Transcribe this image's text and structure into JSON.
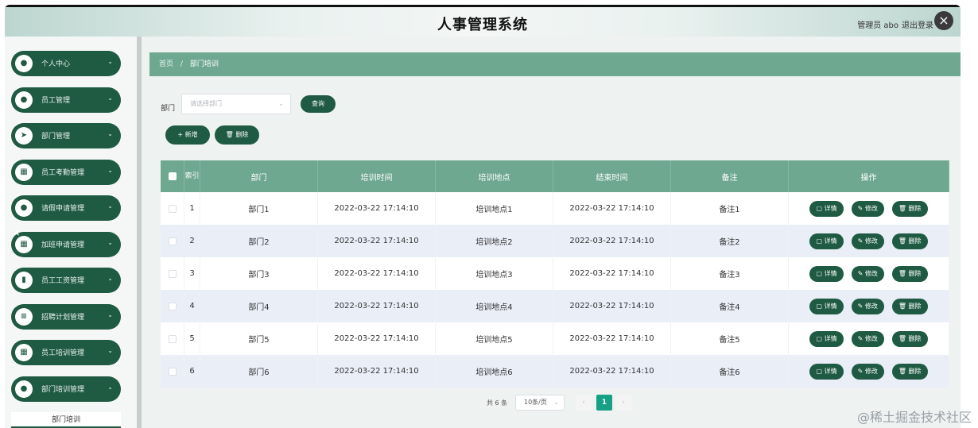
{
  "header": {
    "title": "人事管理系统",
    "admin": "管理员 abo",
    "logout": "退出登录"
  },
  "close_icon": "×",
  "sidebar": {
    "items": [
      {
        "label": "个人中心",
        "icon": "●"
      },
      {
        "label": "员工管理",
        "icon": "●"
      },
      {
        "label": "部门管理",
        "icon": "➤"
      },
      {
        "label": "员工考勤管理",
        "icon": "▦"
      },
      {
        "label": "请假申请管理",
        "icon": "●"
      },
      {
        "label": "加班申请管理",
        "icon": "▦"
      },
      {
        "label": "员工工资管理",
        "icon": "▮"
      },
      {
        "label": "招聘计划管理",
        "icon": "≡"
      },
      {
        "label": "员工培训管理",
        "icon": "▦"
      },
      {
        "label": "部门培训管理",
        "icon": "●"
      }
    ],
    "sub_item": "部门培训",
    "chevron": "⌄",
    "left_arrow": "‹"
  },
  "breadcrumb": {
    "home": "首页",
    "separator": "/",
    "current": "部门培训"
  },
  "filter": {
    "label": "部门",
    "placeholder": "请选择部门",
    "arrow": "⌄",
    "query": "查询"
  },
  "actions": {
    "add": "+ 新增",
    "delete": "🗑 删除"
  },
  "table": {
    "headers": [
      "索引",
      "部门",
      "培训时间",
      "培训地点",
      "结束时间",
      "备注",
      "操作"
    ],
    "rows": [
      {
        "index": "1",
        "dept": "部门1",
        "train_time": "2022-03-22 17:14:10",
        "place": "培训地点1",
        "end_time": "2022-03-22 17:14:10",
        "note": "备注1"
      },
      {
        "index": "2",
        "dept": "部门2",
        "train_time": "2022-03-22 17:14:10",
        "place": "培训地点2",
        "end_time": "2022-03-22 17:14:10",
        "note": "备注2"
      },
      {
        "index": "3",
        "dept": "部门3",
        "train_time": "2022-03-22 17:14:10",
        "place": "培训地点3",
        "end_time": "2022-03-22 17:14:10",
        "note": "备注3"
      },
      {
        "index": "4",
        "dept": "部门4",
        "train_time": "2022-03-22 17:14:10",
        "place": "培训地点4",
        "end_time": "2022-03-22 17:14:10",
        "note": "备注4"
      },
      {
        "index": "5",
        "dept": "部门5",
        "train_time": "2022-03-22 17:14:10",
        "place": "培训地点5",
        "end_time": "2022-03-22 17:14:10",
        "note": "备注5"
      },
      {
        "index": "6",
        "dept": "部门6",
        "train_time": "2022-03-22 17:14:10",
        "place": "培训地点6",
        "end_time": "2022-03-22 17:14:10",
        "note": "备注6"
      }
    ],
    "ops": {
      "detail": "▢ 详情",
      "edit": "✎ 修改",
      "delete": "🗑 删除"
    }
  },
  "pager": {
    "total": "共 6 条",
    "size": "10条/页",
    "arrow": "⌄",
    "prev": "‹",
    "page": "1",
    "next": "›"
  },
  "watermark": "@稀土掘金技术社区",
  "colors": {
    "primary": "#1f5a43",
    "header_green": "#6fa891",
    "active_page": "#16a085"
  }
}
